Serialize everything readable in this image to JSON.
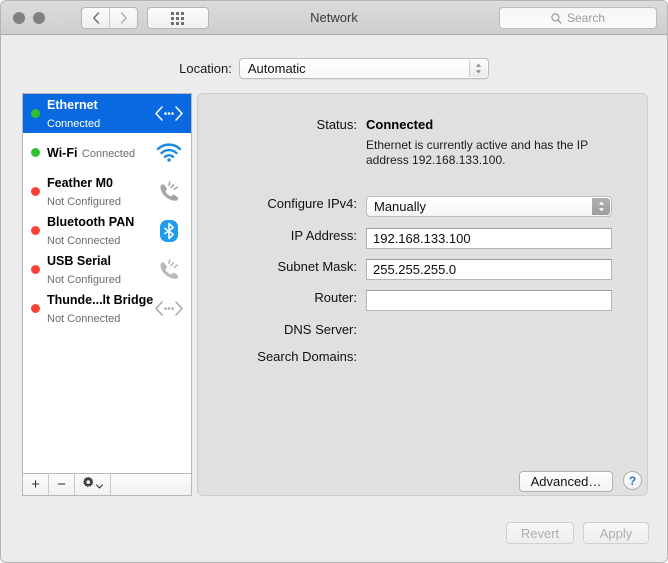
{
  "window": {
    "title": "Network"
  },
  "toolbar": {
    "back_icon": "chevron-left-icon",
    "forward_icon": "chevron-right-icon",
    "grid_icon": "grid-icon",
    "search_placeholder": "Search",
    "search_icon": "search-icon"
  },
  "location": {
    "label": "Location:",
    "selected": "Automatic"
  },
  "sidebar": {
    "interfaces": [
      {
        "name": "Ethernet",
        "status": "Connected",
        "dot": "green",
        "icon": "ethernet-icon",
        "selected": true
      },
      {
        "name": "Wi-Fi",
        "status": "Connected",
        "dot": "green",
        "icon": "wifi-icon",
        "selected": false
      },
      {
        "name": "Feather M0",
        "status": "Not Configured",
        "dot": "red",
        "icon": "modem-icon",
        "selected": false
      },
      {
        "name": "Bluetooth PAN",
        "status": "Not Connected",
        "dot": "red",
        "icon": "bluetooth-icon",
        "selected": false
      },
      {
        "name": "USB Serial",
        "status": "Not Configured",
        "dot": "red",
        "icon": "modem-icon",
        "selected": false
      },
      {
        "name": "Thunde...lt Bridge",
        "status": "Not Connected",
        "dot": "red",
        "icon": "thunderbolt-icon",
        "selected": false
      }
    ],
    "add_label": "+",
    "remove_label": "−",
    "gear_label": "gear-icon"
  },
  "detail": {
    "status_label": "Status:",
    "status_value": "Connected",
    "status_description": "Ethernet is currently active and has the IP address 192.168.133.100.",
    "configure_label": "Configure IPv4:",
    "configure_value": "Manually",
    "ip_label": "IP Address:",
    "ip_value": "192.168.133.100",
    "subnet_label": "Subnet Mask:",
    "subnet_value": "255.255.255.0",
    "router_label": "Router:",
    "router_value": "",
    "dns_label": "DNS Server:",
    "dns_value": "",
    "search_domains_label": "Search Domains:",
    "search_domains_value": "",
    "advanced_label": "Advanced…",
    "help_label": "?"
  },
  "footer": {
    "revert_label": "Revert",
    "apply_label": "Apply"
  },
  "colors": {
    "selection_blue": "#0a69e1",
    "status_green": "#30c22e",
    "status_red": "#fb4238",
    "window_bg": "#ececec",
    "panel_bg": "#e0e0e0"
  }
}
